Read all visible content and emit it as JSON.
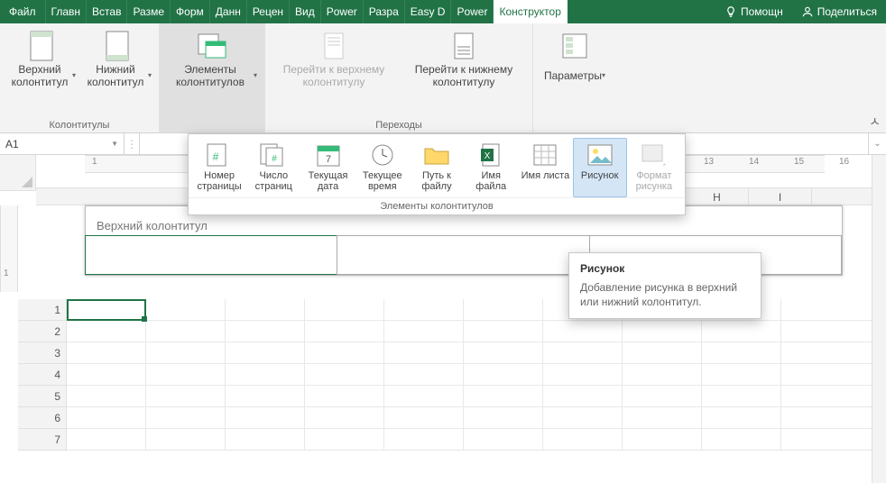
{
  "tabs": {
    "file": "Файл",
    "list": [
      "Главн",
      "Встав",
      "Разме",
      "Форм",
      "Данн",
      "Рецен",
      "Вид",
      "Power",
      "Разра",
      "Easy D",
      "Power"
    ],
    "active": "Конструктор",
    "help_icon": "lightbulb-icon",
    "help": "Помощн",
    "share_icon": "person-icon",
    "share": "Поделиться"
  },
  "ribbon": {
    "group1": {
      "caption": "Колонтитулы",
      "btn1": "Верхний колонтитул",
      "btn2": "Нижний колонтитул"
    },
    "group2": {
      "caption": "",
      "btn1": "Элементы колонтитулов"
    },
    "group3": {
      "caption": "Переходы",
      "btn1": "Перейти к верхнему колонтитулу",
      "btn2": "Перейти к нижнему колонтитулу"
    },
    "group4": {
      "caption": "",
      "btn1": "Параметры"
    }
  },
  "namebox": "A1",
  "gallery": {
    "caption": "Элементы колонтитулов",
    "items": [
      {
        "label": "Номер страницы"
      },
      {
        "label": "Число страниц"
      },
      {
        "label": "Текущая дата"
      },
      {
        "label": "Текущее время"
      },
      {
        "label": "Путь к файлу"
      },
      {
        "label": "Имя файла"
      },
      {
        "label": "Имя листа"
      },
      {
        "label": "Рисунок",
        "hover": true
      },
      {
        "label": "Формат рисунка",
        "disabled": true
      }
    ]
  },
  "tooltip": {
    "title": "Рисунок",
    "body": "Добавление рисунка в верхний или нижний колонтитул."
  },
  "sheet": {
    "header_label": "Верхний колонтитул",
    "cols": [
      "H",
      "I"
    ],
    "ruler_ticks": [
      "1",
      "13",
      "14",
      "15",
      "16"
    ],
    "rows": [
      "1",
      "2",
      "3",
      "4",
      "5",
      "6",
      "7"
    ]
  }
}
